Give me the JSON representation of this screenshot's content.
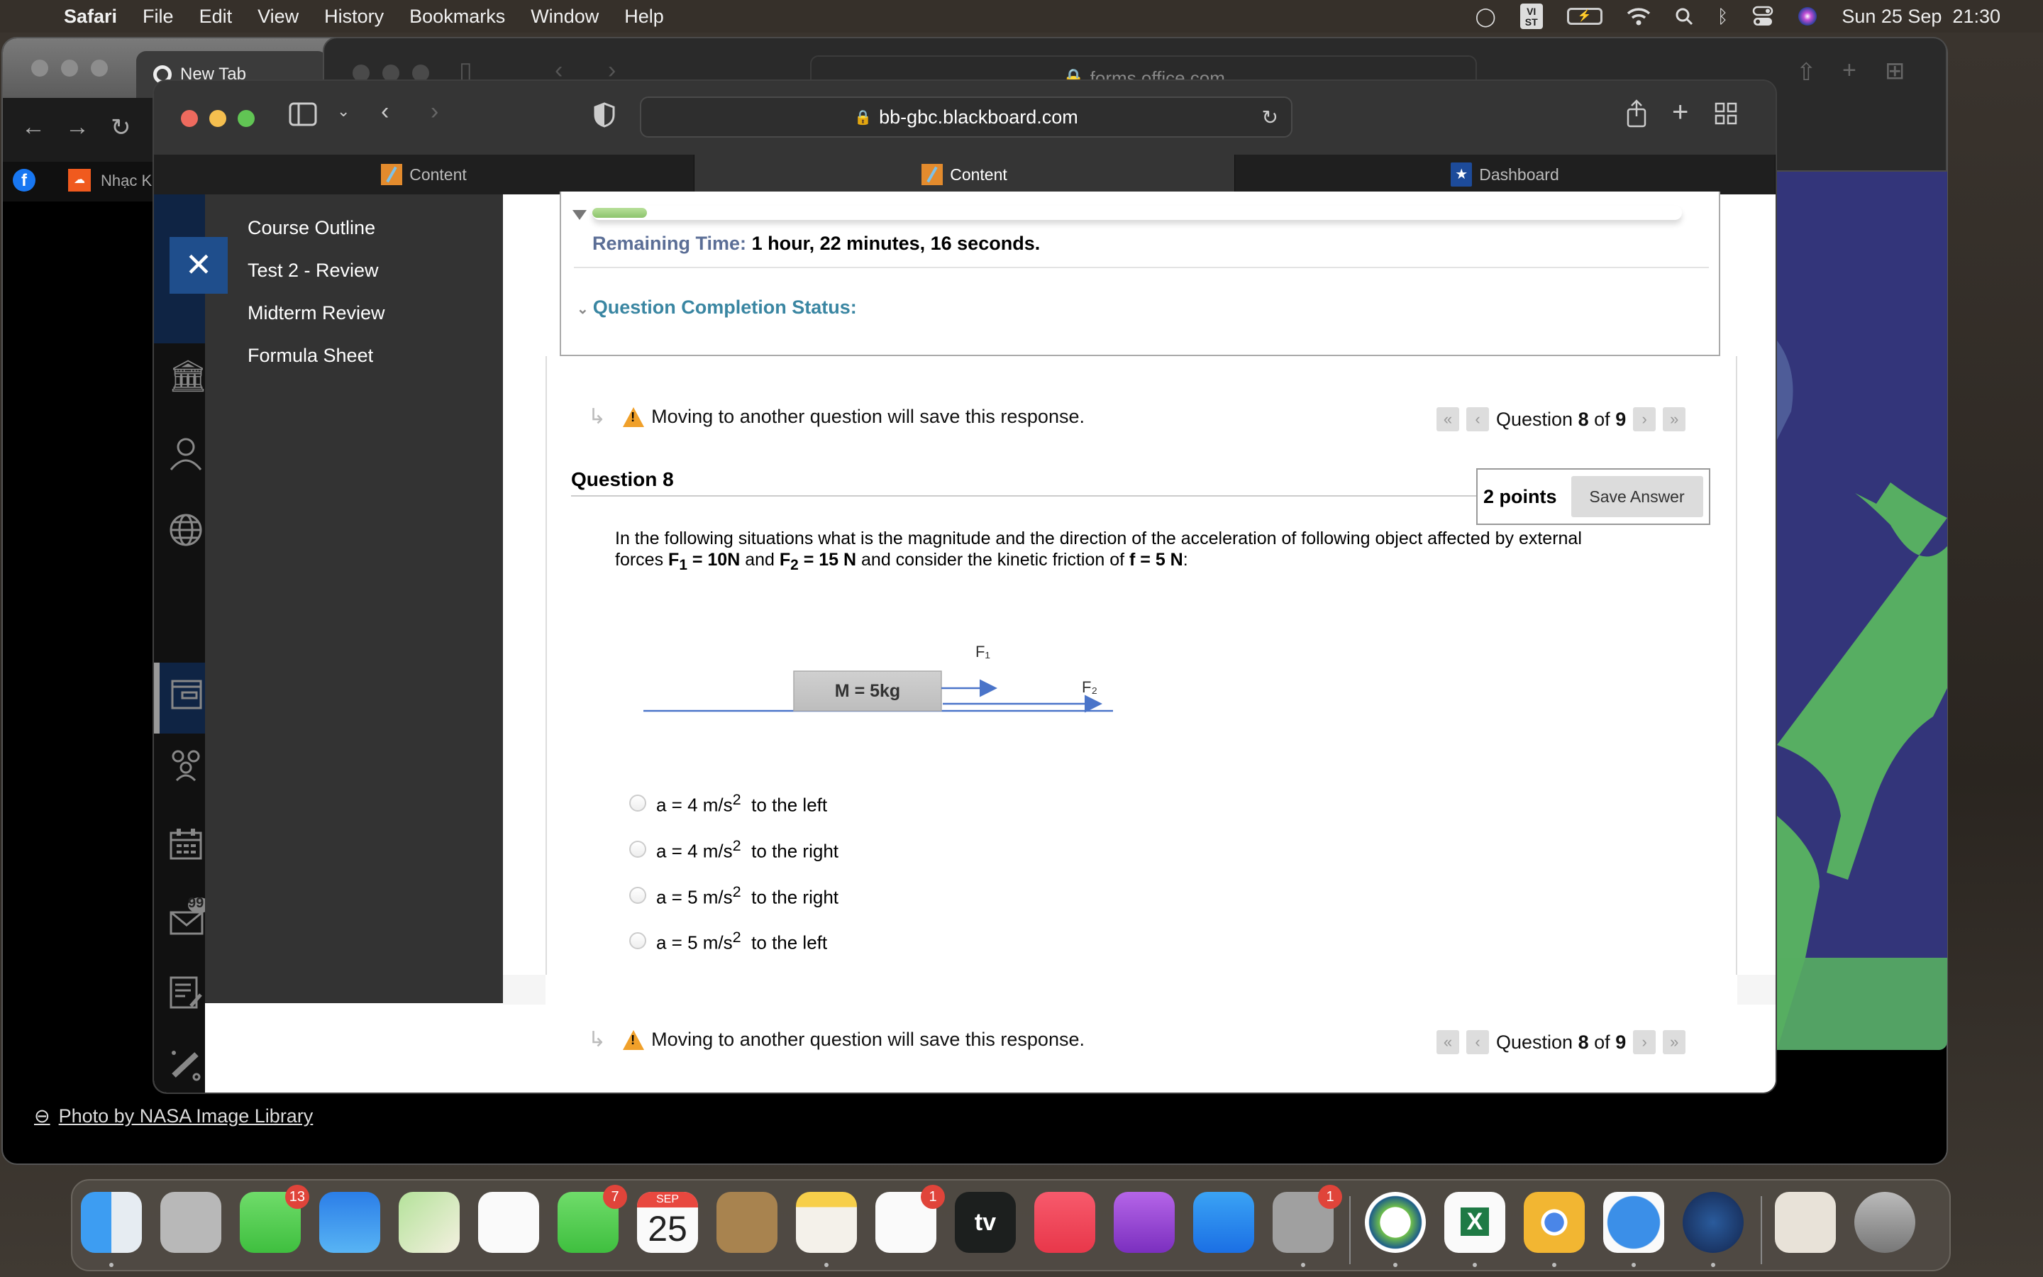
{
  "menubar": {
    "app_name": "Safari",
    "items": [
      "File",
      "Edit",
      "View",
      "History",
      "Bookmarks",
      "Window",
      "Help"
    ],
    "keyboard_input": "VI\nST",
    "datetime": "Sun 25 Sep  21:30"
  },
  "chrome_window": {
    "tab_title": "New Tab",
    "bookmark_label": "Nhạc K",
    "photo_credit": "Photo by NASA Image Library"
  },
  "background_safari": {
    "url": "forms.office.com"
  },
  "safari": {
    "url": "bb-gbc.blackboard.com",
    "tabs": [
      {
        "label": "Content",
        "icon": "pencil-icon",
        "active": false
      },
      {
        "label": "Content",
        "icon": "pencil-icon",
        "active": true
      },
      {
        "label": "Dashboard",
        "icon": "star-badge-icon",
        "active": false
      }
    ]
  },
  "sidebar": {
    "menu_items": [
      "Course Outline",
      "Test 2 - Review",
      "Midterm Review",
      "Formula Sheet"
    ],
    "rail_icons": [
      "institution-icon",
      "profile-icon",
      "globe-icon",
      "courses-icon",
      "groups-icon",
      "calendar-icon",
      "messages-icon",
      "grades-icon",
      "tools-icon",
      "edit-icon"
    ],
    "messages_badge": "99"
  },
  "test": {
    "progress_fraction": 0.05,
    "remaining_time_label": "Remaining Time:",
    "remaining_time_value": "1 hour, 22 minutes, 16 seconds.",
    "completion_status_label": "Question Completion Status:",
    "warning_text": "Moving to another question will save this response.",
    "nav": {
      "prefix": "Question",
      "current": "8",
      "of": "of",
      "total": "9"
    },
    "question_title": "Question 8",
    "points": "2 points",
    "save_label": "Save Answer",
    "question_text_1": "In the following situations what is the magnitude and the direction of the acceleration of following object affected by external forces ",
    "f1_label": "F",
    "f1_sub": "1",
    "f1_value": " = 10N",
    "and_text": " and ",
    "f2_label": "F",
    "f2_sub": "2",
    "f2_value": " = 15 N",
    "question_text_2": " and consider the kinetic friction of ",
    "friction": "f = 5 N",
    "question_text_end": ":",
    "diagram": {
      "mass_label": "M = 5kg",
      "f1": "F₁",
      "f2": "F₂"
    },
    "options": [
      {
        "value": "a = 4 m/s",
        "sup": "2",
        "direction": "to the left"
      },
      {
        "value": "a = 4 m/s",
        "sup": "2",
        "direction": "to the right"
      },
      {
        "value": "a = 5 m/s",
        "sup": "2",
        "direction": "to the right"
      },
      {
        "value": "a = 5 m/s",
        "sup": "2",
        "direction": "to the left"
      }
    ]
  },
  "dock": {
    "apps": [
      {
        "name": "Finder",
        "badge": ""
      },
      {
        "name": "Launchpad",
        "badge": ""
      },
      {
        "name": "Messages",
        "badge": "13"
      },
      {
        "name": "Mail",
        "badge": ""
      },
      {
        "name": "Maps",
        "badge": ""
      },
      {
        "name": "Photos",
        "badge": ""
      },
      {
        "name": "FaceTime",
        "badge": "7"
      },
      {
        "name": "Calendar",
        "badge": "",
        "month": "SEP",
        "day": "25"
      },
      {
        "name": "Contacts",
        "badge": ""
      },
      {
        "name": "Notes",
        "badge": ""
      },
      {
        "name": "Reminders",
        "badge": "1"
      },
      {
        "name": "TV",
        "badge": "",
        "label": "tv"
      },
      {
        "name": "Music",
        "badge": ""
      },
      {
        "name": "Podcasts",
        "badge": ""
      },
      {
        "name": "App Store",
        "badge": ""
      },
      {
        "name": "System Preferences",
        "badge": "1"
      },
      {
        "name": "Webex",
        "badge": ""
      },
      {
        "name": "Excel",
        "badge": "",
        "label": "X"
      },
      {
        "name": "Chrome",
        "badge": ""
      },
      {
        "name": "Safari",
        "badge": ""
      },
      {
        "name": "Steam",
        "badge": ""
      },
      {
        "name": "Document",
        "badge": ""
      },
      {
        "name": "Trash",
        "badge": ""
      }
    ]
  }
}
